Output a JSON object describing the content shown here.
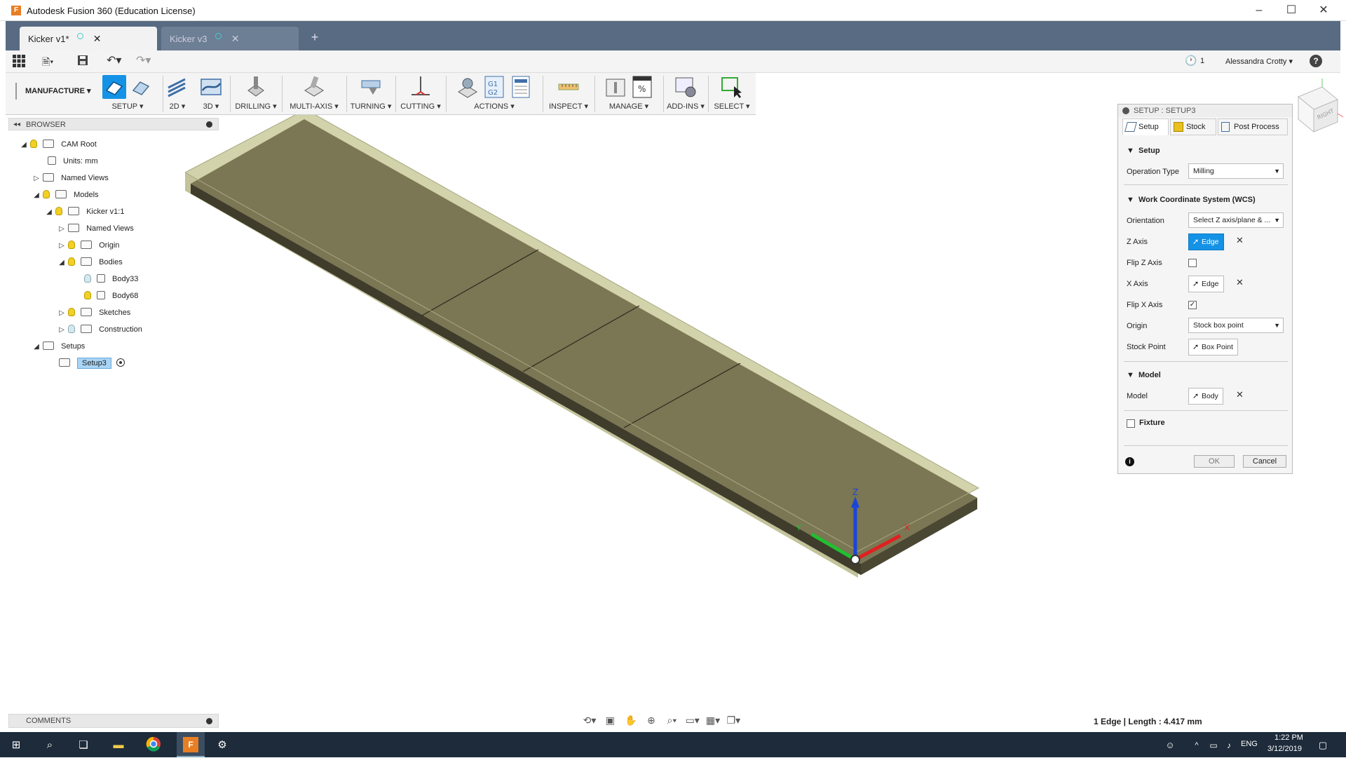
{
  "window": {
    "title": "Autodesk Fusion 360 (Education License)"
  },
  "tabs": [
    {
      "label": "Kicker v1*",
      "active": true
    },
    {
      "label": "Kicker v3",
      "active": false
    }
  ],
  "quickbar": {
    "jobs_count": "1",
    "user": "Alessandra Crotty",
    "help": "?"
  },
  "ribbon": {
    "workspace": "MANUFACTURE",
    "groups": [
      "SETUP",
      "2D",
      "3D",
      "DRILLING",
      "MULTI-AXIS",
      "TURNING",
      "CUTTING",
      "ACTIONS",
      "INSPECT",
      "MANAGE",
      "ADD-INS",
      "SELECT"
    ]
  },
  "browser": {
    "title": "BROWSER",
    "items": [
      "CAM Root",
      "Units: mm",
      "Named Views",
      "Models",
      "Kicker v1:1",
      "Named Views",
      "Origin",
      "Bodies",
      "Body33",
      "Body68",
      "Sketches",
      "Construction",
      "Setups",
      "Setup3"
    ]
  },
  "comments": {
    "title": "COMMENTS"
  },
  "status": {
    "text": "1 Edge | Length : 4.417 mm"
  },
  "viewcube": {
    "face_label": "RIGHT"
  },
  "axes": {
    "z": "Z",
    "x": "X",
    "y": "Y"
  },
  "setup_panel": {
    "title": "SETUP : SETUP3",
    "tabs": [
      "Setup",
      "Stock",
      "Post Process"
    ],
    "sections": {
      "setup": "Setup",
      "wcs": "Work Coordinate System (WCS)",
      "model": "Model",
      "fixture": "Fixture"
    },
    "fields": {
      "operation_type": {
        "label": "Operation Type",
        "value": "Milling"
      },
      "orientation": {
        "label": "Orientation",
        "value": "Select Z axis/plane & ..."
      },
      "z_axis": {
        "label": "Z Axis",
        "value": "Edge"
      },
      "flip_z": {
        "label": "Flip Z Axis",
        "checked": false
      },
      "x_axis": {
        "label": "X Axis",
        "value": "Edge"
      },
      "flip_x": {
        "label": "Flip X Axis",
        "checked": true
      },
      "origin": {
        "label": "Origin",
        "value": "Stock box point"
      },
      "stock_point": {
        "label": "Stock Point",
        "value": "Box Point"
      },
      "model": {
        "label": "Model",
        "value": "Body"
      }
    },
    "ok": "OK",
    "cancel": "Cancel"
  },
  "taskbar": {
    "lang": "ENG",
    "time": "1:22 PM",
    "date": "3/12/2019"
  },
  "colors": {
    "stock": "#c8c89a",
    "body": "#7a7552",
    "accent": "#1492e6",
    "tabbar": "#586b82"
  }
}
